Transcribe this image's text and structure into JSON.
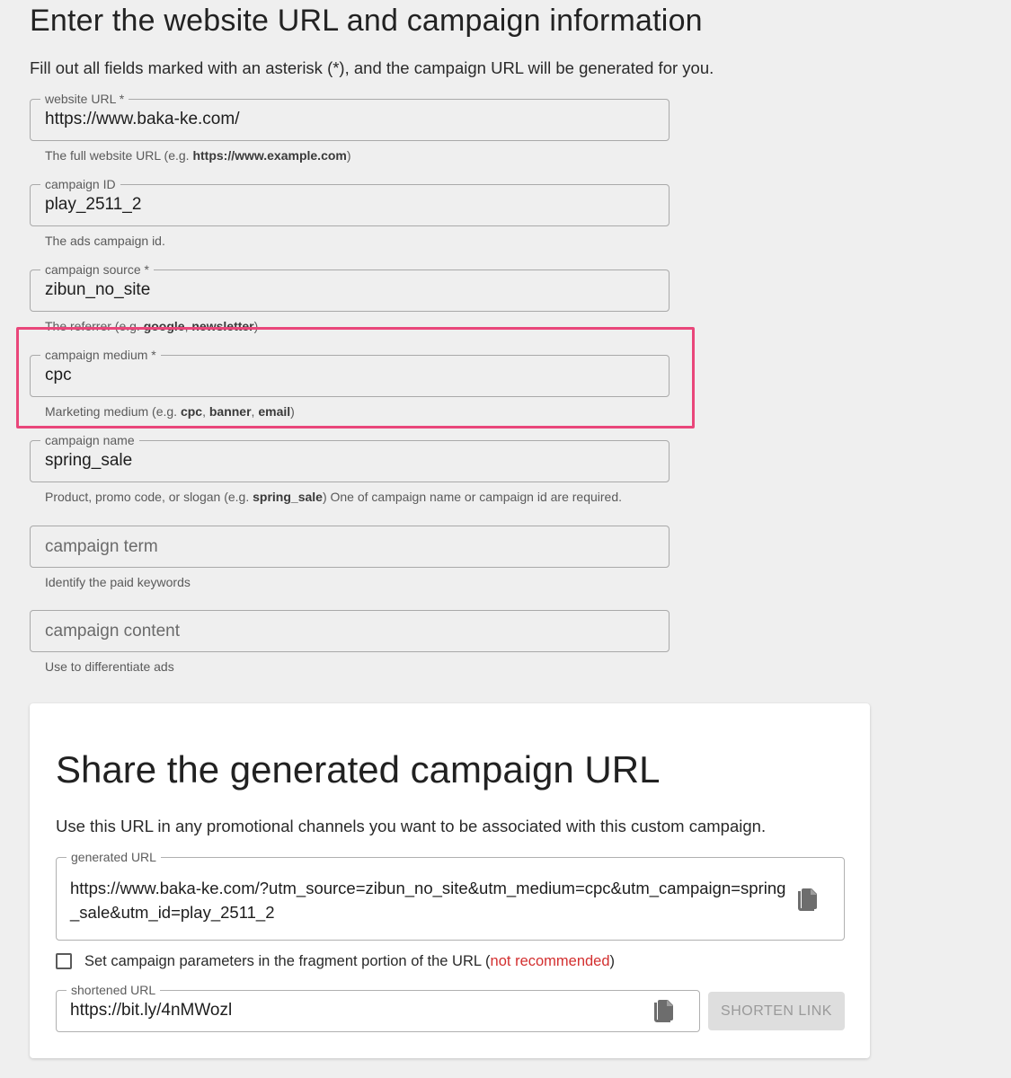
{
  "heading": "Enter the website URL and campaign information",
  "intro": "Fill out all fields marked with an asterisk (*), and the campaign URL will be generated for you.",
  "fields": {
    "website_url": {
      "label": "website URL *",
      "value": "https://www.baka-ke.com/",
      "hint_pre": "The full website URL (e.g. ",
      "hint_bold": "https://www.example.com",
      "hint_post": ")"
    },
    "campaign_id": {
      "label": "campaign ID",
      "value": "play_2511_2",
      "hint": "The ads campaign id."
    },
    "campaign_source": {
      "label": "campaign source *",
      "value": "zibun_no_site",
      "hint_pre": "The referrer (e.g. ",
      "hint_bold1": "google",
      "hint_sep": ", ",
      "hint_bold2": "newsletter",
      "hint_post": ")"
    },
    "campaign_medium": {
      "label": "campaign medium *",
      "value": "cpc",
      "hint_pre": "Marketing medium (e.g. ",
      "hint_bold1": "cpc",
      "hint_sep1": ", ",
      "hint_bold2": "banner",
      "hint_sep2": ", ",
      "hint_bold3": "email",
      "hint_post": ")"
    },
    "campaign_name": {
      "label": "campaign name",
      "value": "spring_sale",
      "hint_pre": "Product, promo code, or slogan (e.g. ",
      "hint_bold": "spring_sale",
      "hint_post": ") One of campaign name or campaign id are required."
    },
    "campaign_term": {
      "placeholder": "campaign term",
      "hint": "Identify the paid keywords"
    },
    "campaign_content": {
      "placeholder": "campaign content",
      "hint": "Use to differentiate ads"
    }
  },
  "share": {
    "title": "Share the generated campaign URL",
    "description": "Use this URL in any promotional channels you want to be associated with this custom campaign.",
    "generated_label": "generated URL",
    "generated_url": "https://www.baka-ke.com/?utm_source=zibun_no_site&utm_medium=cpc&utm_campaign=spring_sale&utm_id=play_2511_2",
    "fragment_checkbox": {
      "checked": false,
      "label_pre": "Set campaign parameters in the fragment portion of the URL (",
      "label_warn": "not recommended",
      "label_post": ")"
    },
    "shortened_label": "shortened URL",
    "shortened_url": "https://bit.ly/4nMWozl",
    "shorten_button": "SHORTEN LINK"
  },
  "colors": {
    "page_bg": "#efefef",
    "highlight": "#e9467a",
    "warning": "#d32f2f",
    "button_disabled_bg": "#dedede"
  },
  "icons": {
    "copy_generated": "content-copy-icon",
    "copy_shortened": "content-copy-icon"
  }
}
